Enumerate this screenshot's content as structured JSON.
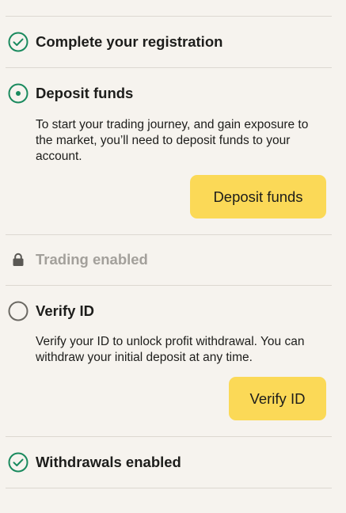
{
  "steps": [
    {
      "icon": "check-circle-icon",
      "title": "Complete your registration"
    },
    {
      "icon": "active-step-icon",
      "title": "Deposit funds",
      "description": "To start your trading journey, and gain exposure to the market, you’ll need to deposit funds to your account.",
      "button": "Deposit funds"
    },
    {
      "icon": "lock-icon",
      "title": "Trading enabled"
    },
    {
      "icon": "empty-circle-icon",
      "title": "Verify ID",
      "description": "Verify your ID to unlock profit withdrawal. You can withdraw your initial deposit at any time.",
      "button": "Verify ID"
    },
    {
      "icon": "check-circle-icon",
      "title": "Withdrawals enabled"
    }
  ],
  "colors": {
    "background": "#f6f3ee",
    "accent_green": "#1a8a5e",
    "button_yellow": "#fbd957",
    "muted_text": "#a3a09b",
    "divider": "#dcd8d1"
  }
}
